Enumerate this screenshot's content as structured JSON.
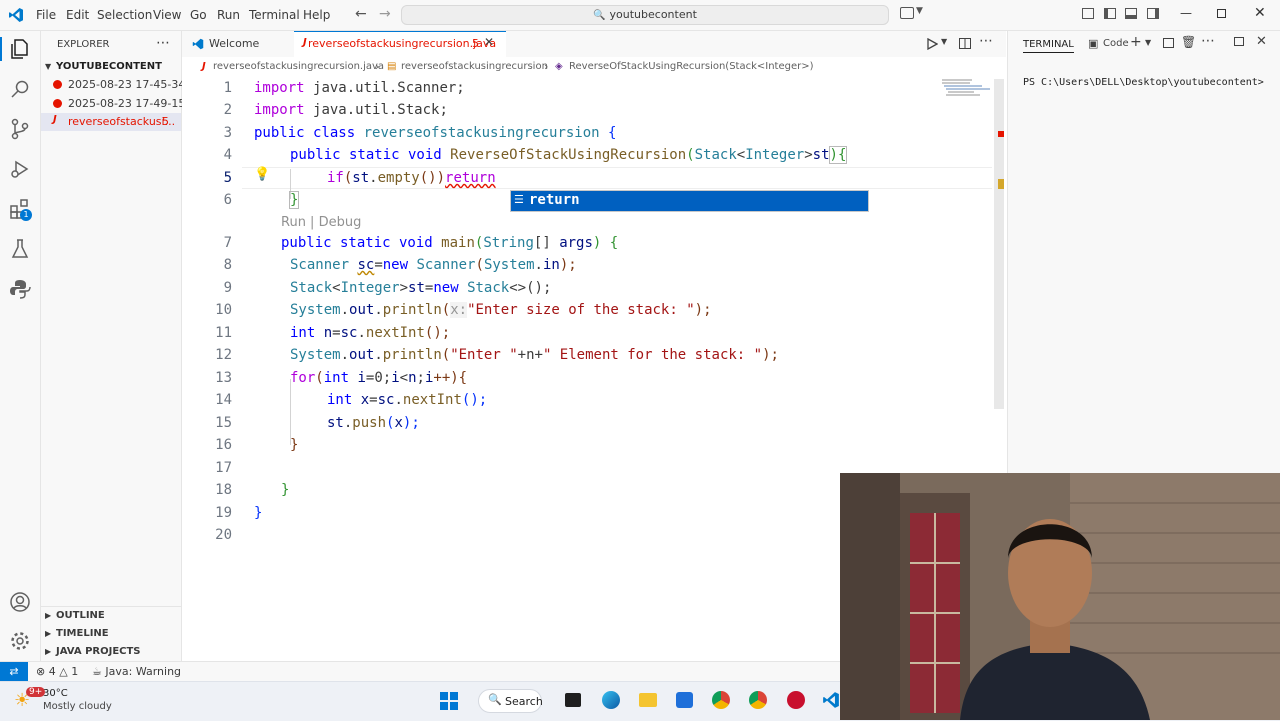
{
  "titlebar": {
    "menus": [
      "File",
      "Edit",
      "Selection",
      "View",
      "Go",
      "Run",
      "Terminal",
      "Help"
    ],
    "search_text": "youtubecontent"
  },
  "sidebar": {
    "title": "EXPLORER",
    "folder": "YOUTUBECONTENT",
    "files": [
      {
        "name": "2025-08-23 17-45-34...",
        "status": "red"
      },
      {
        "name": "2025-08-23 17-49-15...",
        "status": "red"
      },
      {
        "name": "reverseofstackusi...",
        "badge": "5"
      }
    ],
    "sections": [
      "OUTLINE",
      "TIMELINE",
      "JAVA PROJECTS"
    ]
  },
  "tabs": [
    {
      "label": "Welcome"
    },
    {
      "label": "reverseofstackusingrecursion.java",
      "badge": "5"
    }
  ],
  "breadcrumb": [
    "reverseofstackusingrecursion.java",
    "reverseofstackusingrecursion",
    "ReverseOfStackUsingRecursion(Stack<Integer>)"
  ],
  "editor": {
    "line_numbers": [
      "1",
      "2",
      "3",
      "4",
      "5",
      "6",
      "7",
      "8",
      "9",
      "10",
      "11",
      "12",
      "13",
      "14",
      "15",
      "16",
      "17",
      "18",
      "19",
      "20"
    ],
    "codelens": "Run | Debug",
    "suggestion": "return",
    "lines": {
      "l1": [
        "import",
        "java.util.Scanner;"
      ],
      "l2": [
        "import",
        "java.util.Stack;"
      ],
      "l3": [
        "public class",
        "reverseofstackusingrecursion",
        "{"
      ],
      "l4": [
        "public static void",
        "ReverseOfStackUsingRecursion",
        "(",
        "Stack",
        "<",
        "Integer",
        ">",
        "st",
        "){"
      ],
      "l5": [
        "if",
        "(",
        "st",
        ".",
        "empty",
        "())",
        "return"
      ],
      "l6": [
        "}"
      ],
      "l7": [
        "public static void",
        "main",
        "(",
        "String",
        "[]",
        "args",
        ")",
        "{"
      ],
      "l8": [
        "Scanner",
        "sc",
        "=",
        "new",
        "Scanner",
        "(",
        "System",
        ".",
        "in",
        ");"
      ],
      "l9": [
        "Stack",
        "<",
        "Integer",
        ">",
        "st",
        "=",
        "new",
        "Stack",
        "<>();"
      ],
      "l10": [
        "System",
        ".",
        "out",
        ".",
        "println",
        "(",
        "x:",
        "\"Enter size of the stack: \"",
        ");"
      ],
      "l11": [
        "int",
        "n",
        "=",
        "sc",
        ".",
        "nextInt",
        "();"
      ],
      "l12": [
        "System",
        ".",
        "out",
        ".",
        "println",
        "(",
        "\"Enter \"",
        "+n+",
        "\" Element for the stack: \"",
        ");"
      ],
      "l13": [
        "for",
        "(",
        "int",
        "i",
        "=0;",
        "i",
        "<",
        "n",
        ";",
        "i",
        "++){"
      ],
      "l14": [
        "int",
        "x",
        "=",
        "sc",
        ".",
        "nextInt",
        "();"
      ],
      "l15": [
        "st",
        ".",
        "push",
        "(",
        "x",
        ");"
      ],
      "l16": [
        "}"
      ],
      "l18": [
        "}"
      ],
      "l19": [
        "}"
      ]
    }
  },
  "terminal": {
    "title": "TERMINAL",
    "shell": "Code",
    "prompt": "PS C:\\Users\\DELL\\Desktop\\youtubecontent>"
  },
  "statusbar": {
    "errors": "4",
    "warnings": "1",
    "java": "Java: Warning"
  },
  "taskbar": {
    "weather_badge": "9+",
    "temp": "30°C",
    "weather": "Mostly cloudy",
    "search": "Search"
  },
  "colors": {
    "accent": "#0078d4",
    "error": "#e51400",
    "suggest_bg": "#0060c0"
  }
}
